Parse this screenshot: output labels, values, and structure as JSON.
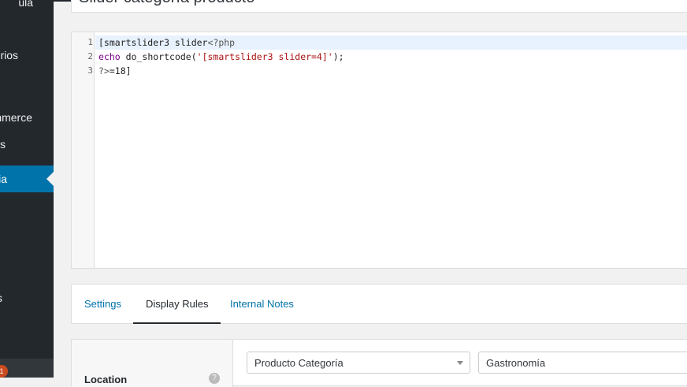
{
  "title": {
    "value": "Slider categoría producto"
  },
  "sidebar": {
    "items": [
      {
        "label": "ula"
      },
      {
        "label": "rios"
      },
      {
        "label": "nmerce"
      },
      {
        "label": "s"
      },
      {
        "label": "ia"
      },
      {
        "label": "s"
      }
    ],
    "badge": "1"
  },
  "editor": {
    "line_numbers": [
      "1",
      "2",
      "3"
    ],
    "lines": [
      {
        "plain": "[smartslider3 slider",
        "meta": "<?php"
      },
      {
        "kw": "echo",
        "fn": " do_shortcode(",
        "str": "'[smartslider3 slider=4]'",
        "end": ");"
      },
      {
        "meta": "?>",
        "rest": "=18]"
      }
    ]
  },
  "tabs": [
    {
      "label": "Settings"
    },
    {
      "label": "Display Rules"
    },
    {
      "label": "Internal Notes"
    }
  ],
  "rules": {
    "label": "Location",
    "help": "?",
    "select1": "Producto Categoría",
    "select2": "Gastronomía"
  },
  "colors": {
    "sidebar": "#23282d",
    "sidebar_active": "#0073aa",
    "link": "#0073aa",
    "badge": "#ca4a1f"
  }
}
